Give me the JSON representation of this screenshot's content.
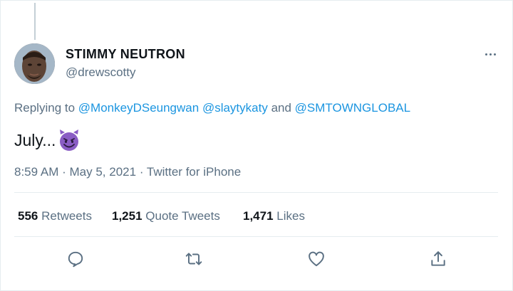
{
  "tweet": {
    "author": {
      "name": "STIMMY NEUTRON",
      "handle": "@drewscotty"
    },
    "replying": {
      "prefix": "Replying to",
      "mention1": "@MonkeyDSeungwan",
      "mention2": "@slaytykaty",
      "conjunction": "and",
      "mention3": "@SMTOWNGLOBAL"
    },
    "text": "July...",
    "emoji_icon": "smiling-imp-emoji",
    "meta": {
      "time": "8:59 AM",
      "sep1": "·",
      "date": "May 5, 2021",
      "sep2": "·",
      "source": "Twitter for iPhone"
    },
    "stats": {
      "retweets": {
        "count": "556",
        "label": "Retweets"
      },
      "quotes": {
        "count": "1,251",
        "label": "Quote Tweets"
      },
      "likes": {
        "count": "1,471",
        "label": "Likes"
      }
    },
    "actions": [
      "reply-icon",
      "retweet-icon",
      "like-icon",
      "share-icon"
    ]
  },
  "colors": {
    "link": "#1b95e0",
    "secondary": "#5b7083",
    "text": "#0f1419",
    "border": "#e6ecf0",
    "emoji": "#8a5dc4"
  }
}
